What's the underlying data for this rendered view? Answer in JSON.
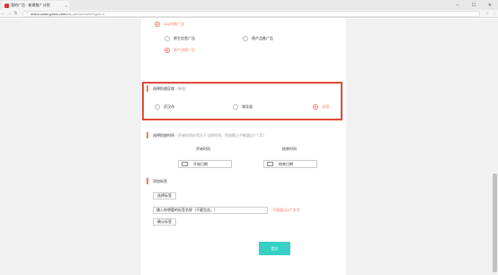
{
  "browser": {
    "tab_title": "我的广告 · 新建推广计划",
    "tab_close": "×",
    "win_min": "─",
    "win_max": "☐",
    "win_close": "✕",
    "url_host": "union.zzsrc.jpbcs.com/",
    "url_path": "ad_server/html/?type=1",
    "star": "☆",
    "menu": "⋮"
  },
  "ad_type": {
    "main_option": "App内推广告",
    "sub_options": [
      {
        "label": "原生信息广告",
        "selected": false
      },
      {
        "label": "原产品推广告",
        "selected": false
      },
      {
        "label": "原产流程广告",
        "selected": true
      }
    ]
  },
  "region": {
    "title": "选择投放区域",
    "hint": "（单选）",
    "options": [
      {
        "label": "武汉市",
        "selected": false
      },
      {
        "label": "湖北省",
        "selected": false
      },
      {
        "label": "全国",
        "selected": true
      }
    ]
  },
  "schedule": {
    "title": "选择投放时间",
    "hint": "（开始时间必须大于当前时间，投放截止不能超过7个月）",
    "start_label": "开始时间",
    "end_label": "结束时间",
    "start_placeholder": "开始日期",
    "end_placeholder": "结束日期"
  },
  "tags": {
    "title": "添加标签",
    "choose_button": "选择标签",
    "input_placeholder": "输入你想要的标签名称（不要包含。）",
    "limit_hint": "*不能超过6个文字",
    "confirm_button": "确认标签"
  },
  "submit_label": "提交",
  "colors": {
    "accent": "#f17c67",
    "submit": "#36d1c4",
    "highlight": "#e04a3a"
  }
}
